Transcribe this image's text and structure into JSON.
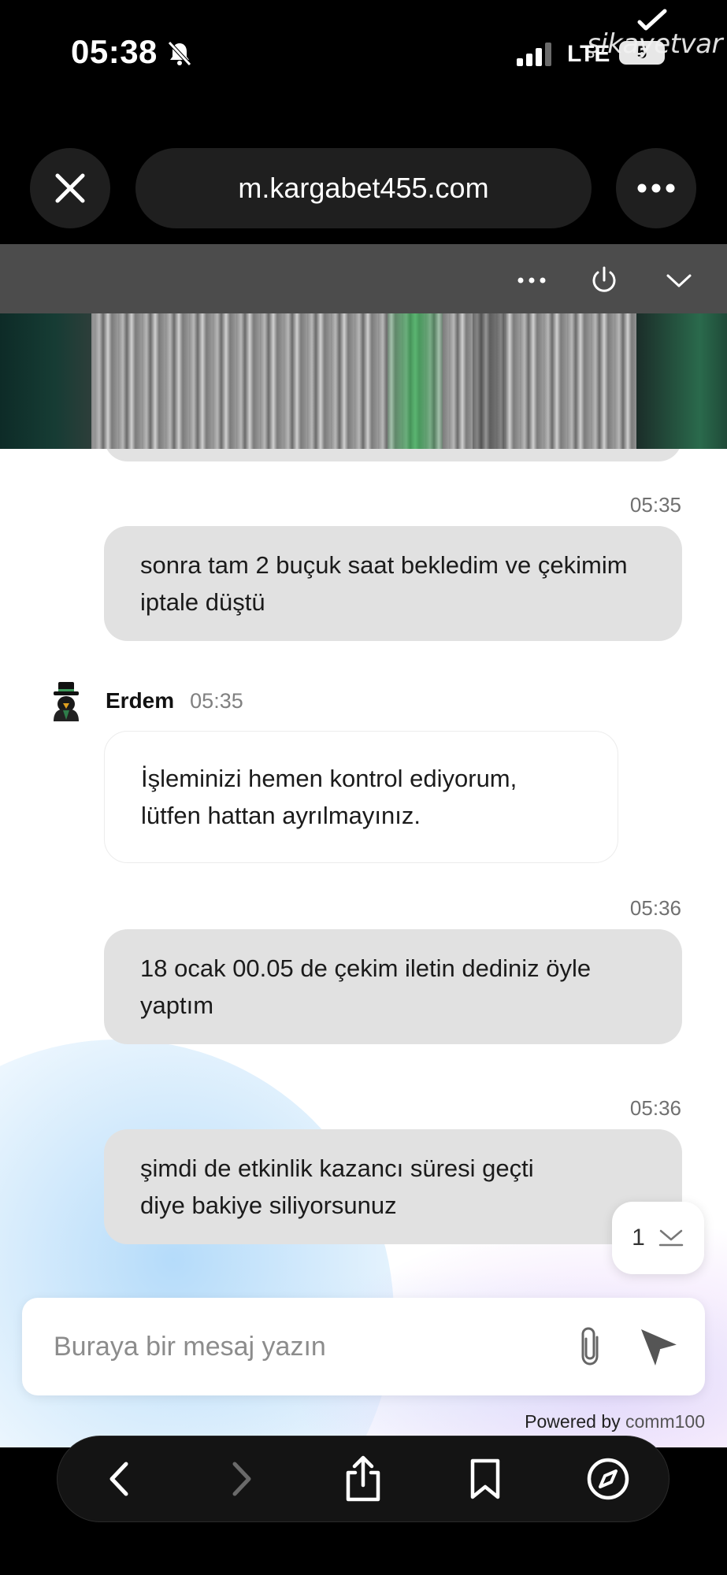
{
  "status_bar": {
    "time": "05:38",
    "network": "LTE",
    "battery": "5",
    "watermark": "şikayetvar"
  },
  "browser": {
    "url": "m.kargabet455.com"
  },
  "chat": {
    "messages": [
      {
        "sender": "user",
        "time": "05:35",
        "text": "sonra tam 2 buçuk saat bekledim ve çekimim iptale düştü"
      },
      {
        "sender": "agent",
        "agent_name": "Erdem",
        "time": "05:35",
        "text": "İşleminizi hemen kontrol ediyorum, lütfen hattan ayrılmayınız."
      },
      {
        "sender": "user",
        "time": "05:36",
        "text": "18 ocak 00.05 de çekim iletin dediniz öyle yaptım"
      },
      {
        "sender": "user",
        "time": "05:36",
        "text": "şimdi de etkinlik kazancı süresi geçti diye bakiye siliyorsunuz"
      }
    ],
    "unread_count": "1",
    "composer_placeholder": "Buraya bir mesaj yazın",
    "powered_by_prefix": "Powered by",
    "powered_by_brand": "comm100"
  },
  "colors": {
    "bubble_user": "#e1e1e1",
    "bubble_agent": "#ffffff",
    "chat_header": "#4c4c4c"
  }
}
